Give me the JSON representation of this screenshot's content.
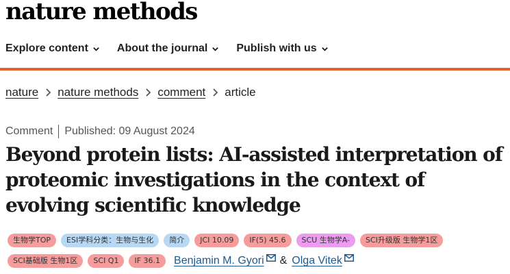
{
  "header": {
    "logo": "nature methods",
    "nav": [
      {
        "label": "Explore content"
      },
      {
        "label": "About the journal"
      },
      {
        "label": "Publish with us"
      }
    ]
  },
  "breadcrumb": {
    "items": [
      "nature",
      "nature methods",
      "comment"
    ],
    "current": "article"
  },
  "article": {
    "type": "Comment",
    "published": "Published: 09 August 2024",
    "title": "Beyond protein lists: AI-assisted interpretation of proteomic investigations in the context of evolving scientific knowledge",
    "authors": [
      "Benjamin M. Gyori",
      "Olga Vitek"
    ],
    "author_separator": "&"
  },
  "tags": {
    "row1": [
      {
        "label": "生物学TOP",
        "color": "#f59c9c"
      },
      {
        "label": "ESI学科分类：生物与生化",
        "color": "#b7d8f5"
      },
      {
        "label": "简介",
        "color": "#b7d8f5"
      },
      {
        "label": "JCI 10.09",
        "color": "#f59c9c"
      },
      {
        "label": "IF(5) 45.6",
        "color": "#f59c9c"
      },
      {
        "label": "SCU 生物学A-",
        "color": "#ec9cee"
      },
      {
        "label": "SCI升级版 生物学1区",
        "color": "#f59c9c"
      }
    ],
    "row2": [
      {
        "label": "SCI基础版 生物1区",
        "color": "#f59c9c"
      },
      {
        "label": "SCI Q1",
        "color": "#f59c9c"
      },
      {
        "label": "IF 36.1",
        "color": "#f59c9c"
      }
    ]
  },
  "colors": {
    "accent": "#e3612f",
    "link": "#1f5a8c"
  },
  "icons": {
    "nav_chevron": "chevron-down-icon",
    "breadcrumb_separator": "chevron-right-icon",
    "author_contact": "mail-icon"
  }
}
